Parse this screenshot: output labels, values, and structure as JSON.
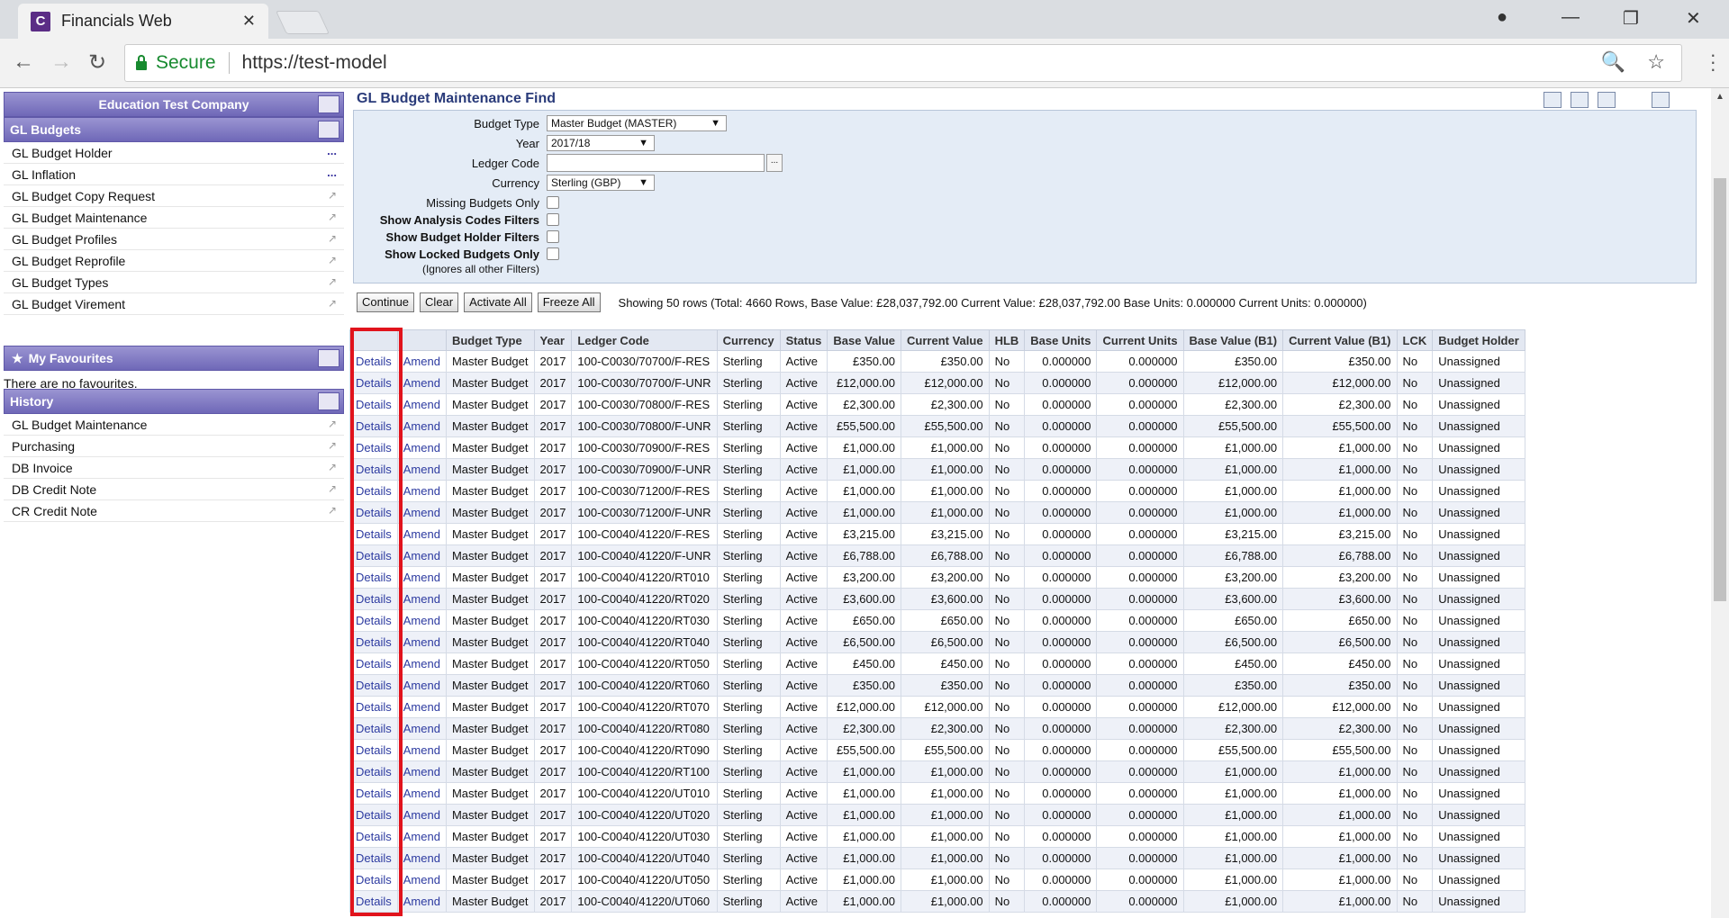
{
  "browser": {
    "tab_title": "Financials Web",
    "tab_icon_letter": "C",
    "secure_label": "Secure",
    "url": "https://test-model"
  },
  "sidebar": {
    "company": "Education Test Company",
    "section_title": "GL Budgets",
    "items": [
      {
        "label": "GL Budget Holder",
        "marker": "..."
      },
      {
        "label": "GL Inflation",
        "marker": "..."
      },
      {
        "label": "GL Budget Copy Request",
        "marker": "↗"
      },
      {
        "label": "GL Budget Maintenance",
        "marker": "↗"
      },
      {
        "label": "GL Budget Profiles",
        "marker": "↗"
      },
      {
        "label": "GL Budget Reprofile",
        "marker": "↗"
      },
      {
        "label": "GL Budget Types",
        "marker": "↗"
      },
      {
        "label": "GL Budget Virement",
        "marker": "↗"
      }
    ],
    "favourites_title": "My Favourites",
    "favourites_empty": "There are no favourites.",
    "history_title": "History",
    "history": [
      {
        "label": "GL Budget Maintenance"
      },
      {
        "label": "Purchasing"
      },
      {
        "label": "DB Invoice"
      },
      {
        "label": "DB Credit Note"
      },
      {
        "label": "CR Credit Note"
      }
    ]
  },
  "main": {
    "title": "GL Budget Maintenance Find",
    "filters": {
      "budget_type_label": "Budget Type",
      "budget_type_value": "Master Budget (MASTER)",
      "year_label": "Year",
      "year_value": "2017/18",
      "ledger_code_label": "Ledger Code",
      "currency_label": "Currency",
      "currency_value": "Sterling (GBP)",
      "missing_budgets_label": "Missing Budgets Only",
      "analysis_codes_label": "Show Analysis Codes Filters",
      "budget_holder_label": "Show Budget Holder Filters",
      "locked_label": "Show Locked Budgets Only",
      "locked_note": "(Ignores all other Filters)"
    },
    "buttons": {
      "continue": "Continue",
      "clear": "Clear",
      "activate_all": "Activate All",
      "freeze_all": "Freeze All"
    },
    "summary": "Showing 50 rows (Total: 4660 Rows, Base Value: £28,037,792.00 Current Value: £28,037,792.00 Base Units: 0.000000 Current Units: 0.000000)"
  },
  "table": {
    "headers": [
      "",
      "",
      "Budget Type",
      "Year",
      "Ledger Code",
      "Currency",
      "Status",
      "Base Value",
      "Current Value",
      "HLB",
      "Base Units",
      "Current Units",
      "Base Value (B1)",
      "Current Value (B1)",
      "LCK",
      "Budget Holder"
    ],
    "details_label": "Details",
    "amend_label": "Amend",
    "rows": [
      {
        "type": "Master Budget",
        "year": "2017",
        "code": "100-C0030/70700/F-RES",
        "cur": "Sterling",
        "status": "Active",
        "bv": "£350.00",
        "cv": "£350.00",
        "hlb": "No",
        "bu": "0.000000",
        "cu": "0.000000",
        "bv1": "£350.00",
        "cv1": "£350.00",
        "lck": "No",
        "holder": "Unassigned"
      },
      {
        "type": "Master Budget",
        "year": "2017",
        "code": "100-C0030/70700/F-UNR",
        "cur": "Sterling",
        "status": "Active",
        "bv": "£12,000.00",
        "cv": "£12,000.00",
        "hlb": "No",
        "bu": "0.000000",
        "cu": "0.000000",
        "bv1": "£12,000.00",
        "cv1": "£12,000.00",
        "lck": "No",
        "holder": "Unassigned"
      },
      {
        "type": "Master Budget",
        "year": "2017",
        "code": "100-C0030/70800/F-RES",
        "cur": "Sterling",
        "status": "Active",
        "bv": "£2,300.00",
        "cv": "£2,300.00",
        "hlb": "No",
        "bu": "0.000000",
        "cu": "0.000000",
        "bv1": "£2,300.00",
        "cv1": "£2,300.00",
        "lck": "No",
        "holder": "Unassigned"
      },
      {
        "type": "Master Budget",
        "year": "2017",
        "code": "100-C0030/70800/F-UNR",
        "cur": "Sterling",
        "status": "Active",
        "bv": "£55,500.00",
        "cv": "£55,500.00",
        "hlb": "No",
        "bu": "0.000000",
        "cu": "0.000000",
        "bv1": "£55,500.00",
        "cv1": "£55,500.00",
        "lck": "No",
        "holder": "Unassigned"
      },
      {
        "type": "Master Budget",
        "year": "2017",
        "code": "100-C0030/70900/F-RES",
        "cur": "Sterling",
        "status": "Active",
        "bv": "£1,000.00",
        "cv": "£1,000.00",
        "hlb": "No",
        "bu": "0.000000",
        "cu": "0.000000",
        "bv1": "£1,000.00",
        "cv1": "£1,000.00",
        "lck": "No",
        "holder": "Unassigned"
      },
      {
        "type": "Master Budget",
        "year": "2017",
        "code": "100-C0030/70900/F-UNR",
        "cur": "Sterling",
        "status": "Active",
        "bv": "£1,000.00",
        "cv": "£1,000.00",
        "hlb": "No",
        "bu": "0.000000",
        "cu": "0.000000",
        "bv1": "£1,000.00",
        "cv1": "£1,000.00",
        "lck": "No",
        "holder": "Unassigned"
      },
      {
        "type": "Master Budget",
        "year": "2017",
        "code": "100-C0030/71200/F-RES",
        "cur": "Sterling",
        "status": "Active",
        "bv": "£1,000.00",
        "cv": "£1,000.00",
        "hlb": "No",
        "bu": "0.000000",
        "cu": "0.000000",
        "bv1": "£1,000.00",
        "cv1": "£1,000.00",
        "lck": "No",
        "holder": "Unassigned"
      },
      {
        "type": "Master Budget",
        "year": "2017",
        "code": "100-C0030/71200/F-UNR",
        "cur": "Sterling",
        "status": "Active",
        "bv": "£1,000.00",
        "cv": "£1,000.00",
        "hlb": "No",
        "bu": "0.000000",
        "cu": "0.000000",
        "bv1": "£1,000.00",
        "cv1": "£1,000.00",
        "lck": "No",
        "holder": "Unassigned"
      },
      {
        "type": "Master Budget",
        "year": "2017",
        "code": "100-C0040/41220/F-RES",
        "cur": "Sterling",
        "status": "Active",
        "bv": "£3,215.00",
        "cv": "£3,215.00",
        "hlb": "No",
        "bu": "0.000000",
        "cu": "0.000000",
        "bv1": "£3,215.00",
        "cv1": "£3,215.00",
        "lck": "No",
        "holder": "Unassigned"
      },
      {
        "type": "Master Budget",
        "year": "2017",
        "code": "100-C0040/41220/F-UNR",
        "cur": "Sterling",
        "status": "Active",
        "bv": "£6,788.00",
        "cv": "£6,788.00",
        "hlb": "No",
        "bu": "0.000000",
        "cu": "0.000000",
        "bv1": "£6,788.00",
        "cv1": "£6,788.00",
        "lck": "No",
        "holder": "Unassigned"
      },
      {
        "type": "Master Budget",
        "year": "2017",
        "code": "100-C0040/41220/RT010",
        "cur": "Sterling",
        "status": "Active",
        "bv": "£3,200.00",
        "cv": "£3,200.00",
        "hlb": "No",
        "bu": "0.000000",
        "cu": "0.000000",
        "bv1": "£3,200.00",
        "cv1": "£3,200.00",
        "lck": "No",
        "holder": "Unassigned"
      },
      {
        "type": "Master Budget",
        "year": "2017",
        "code": "100-C0040/41220/RT020",
        "cur": "Sterling",
        "status": "Active",
        "bv": "£3,600.00",
        "cv": "£3,600.00",
        "hlb": "No",
        "bu": "0.000000",
        "cu": "0.000000",
        "bv1": "£3,600.00",
        "cv1": "£3,600.00",
        "lck": "No",
        "holder": "Unassigned"
      },
      {
        "type": "Master Budget",
        "year": "2017",
        "code": "100-C0040/41220/RT030",
        "cur": "Sterling",
        "status": "Active",
        "bv": "£650.00",
        "cv": "£650.00",
        "hlb": "No",
        "bu": "0.000000",
        "cu": "0.000000",
        "bv1": "£650.00",
        "cv1": "£650.00",
        "lck": "No",
        "holder": "Unassigned"
      },
      {
        "type": "Master Budget",
        "year": "2017",
        "code": "100-C0040/41220/RT040",
        "cur": "Sterling",
        "status": "Active",
        "bv": "£6,500.00",
        "cv": "£6,500.00",
        "hlb": "No",
        "bu": "0.000000",
        "cu": "0.000000",
        "bv1": "£6,500.00",
        "cv1": "£6,500.00",
        "lck": "No",
        "holder": "Unassigned"
      },
      {
        "type": "Master Budget",
        "year": "2017",
        "code": "100-C0040/41220/RT050",
        "cur": "Sterling",
        "status": "Active",
        "bv": "£450.00",
        "cv": "£450.00",
        "hlb": "No",
        "bu": "0.000000",
        "cu": "0.000000",
        "bv1": "£450.00",
        "cv1": "£450.00",
        "lck": "No",
        "holder": "Unassigned"
      },
      {
        "type": "Master Budget",
        "year": "2017",
        "code": "100-C0040/41220/RT060",
        "cur": "Sterling",
        "status": "Active",
        "bv": "£350.00",
        "cv": "£350.00",
        "hlb": "No",
        "bu": "0.000000",
        "cu": "0.000000",
        "bv1": "£350.00",
        "cv1": "£350.00",
        "lck": "No",
        "holder": "Unassigned"
      },
      {
        "type": "Master Budget",
        "year": "2017",
        "code": "100-C0040/41220/RT070",
        "cur": "Sterling",
        "status": "Active",
        "bv": "£12,000.00",
        "cv": "£12,000.00",
        "hlb": "No",
        "bu": "0.000000",
        "cu": "0.000000",
        "bv1": "£12,000.00",
        "cv1": "£12,000.00",
        "lck": "No",
        "holder": "Unassigned"
      },
      {
        "type": "Master Budget",
        "year": "2017",
        "code": "100-C0040/41220/RT080",
        "cur": "Sterling",
        "status": "Active",
        "bv": "£2,300.00",
        "cv": "£2,300.00",
        "hlb": "No",
        "bu": "0.000000",
        "cu": "0.000000",
        "bv1": "£2,300.00",
        "cv1": "£2,300.00",
        "lck": "No",
        "holder": "Unassigned"
      },
      {
        "type": "Master Budget",
        "year": "2017",
        "code": "100-C0040/41220/RT090",
        "cur": "Sterling",
        "status": "Active",
        "bv": "£55,500.00",
        "cv": "£55,500.00",
        "hlb": "No",
        "bu": "0.000000",
        "cu": "0.000000",
        "bv1": "£55,500.00",
        "cv1": "£55,500.00",
        "lck": "No",
        "holder": "Unassigned"
      },
      {
        "type": "Master Budget",
        "year": "2017",
        "code": "100-C0040/41220/RT100",
        "cur": "Sterling",
        "status": "Active",
        "bv": "£1,000.00",
        "cv": "£1,000.00",
        "hlb": "No",
        "bu": "0.000000",
        "cu": "0.000000",
        "bv1": "£1,000.00",
        "cv1": "£1,000.00",
        "lck": "No",
        "holder": "Unassigned"
      },
      {
        "type": "Master Budget",
        "year": "2017",
        "code": "100-C0040/41220/UT010",
        "cur": "Sterling",
        "status": "Active",
        "bv": "£1,000.00",
        "cv": "£1,000.00",
        "hlb": "No",
        "bu": "0.000000",
        "cu": "0.000000",
        "bv1": "£1,000.00",
        "cv1": "£1,000.00",
        "lck": "No",
        "holder": "Unassigned"
      },
      {
        "type": "Master Budget",
        "year": "2017",
        "code": "100-C0040/41220/UT020",
        "cur": "Sterling",
        "status": "Active",
        "bv": "£1,000.00",
        "cv": "£1,000.00",
        "hlb": "No",
        "bu": "0.000000",
        "cu": "0.000000",
        "bv1": "£1,000.00",
        "cv1": "£1,000.00",
        "lck": "No",
        "holder": "Unassigned"
      },
      {
        "type": "Master Budget",
        "year": "2017",
        "code": "100-C0040/41220/UT030",
        "cur": "Sterling",
        "status": "Active",
        "bv": "£1,000.00",
        "cv": "£1,000.00",
        "hlb": "No",
        "bu": "0.000000",
        "cu": "0.000000",
        "bv1": "£1,000.00",
        "cv1": "£1,000.00",
        "lck": "No",
        "holder": "Unassigned"
      },
      {
        "type": "Master Budget",
        "year": "2017",
        "code": "100-C0040/41220/UT040",
        "cur": "Sterling",
        "status": "Active",
        "bv": "£1,000.00",
        "cv": "£1,000.00",
        "hlb": "No",
        "bu": "0.000000",
        "cu": "0.000000",
        "bv1": "£1,000.00",
        "cv1": "£1,000.00",
        "lck": "No",
        "holder": "Unassigned"
      },
      {
        "type": "Master Budget",
        "year": "2017",
        "code": "100-C0040/41220/UT050",
        "cur": "Sterling",
        "status": "Active",
        "bv": "£1,000.00",
        "cv": "£1,000.00",
        "hlb": "No",
        "bu": "0.000000",
        "cu": "0.000000",
        "bv1": "£1,000.00",
        "cv1": "£1,000.00",
        "lck": "No",
        "holder": "Unassigned"
      },
      {
        "type": "Master Budget",
        "year": "2017",
        "code": "100-C0040/41220/UT060",
        "cur": "Sterling",
        "status": "Active",
        "bv": "£1,000.00",
        "cv": "£1,000.00",
        "hlb": "No",
        "bu": "0.000000",
        "cu": "0.000000",
        "bv1": "£1,000.00",
        "cv1": "£1,000.00",
        "lck": "No",
        "holder": "Unassigned"
      }
    ]
  },
  "colors": {
    "highlight_box": "#e1131c",
    "link": "#2c3aa0",
    "sidebar_header": "#6f68b8"
  }
}
